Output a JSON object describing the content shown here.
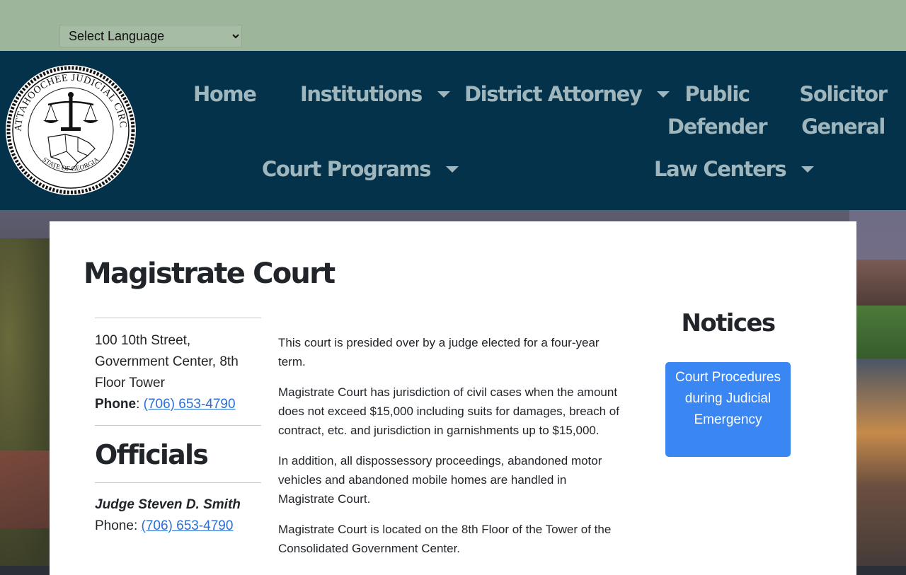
{
  "language_select": {
    "selected": "Select Language"
  },
  "colors": {
    "topbar": "#9db59b",
    "nav": "#05324b",
    "nav_text": "#9fb6bd",
    "accent": "#3a86f2",
    "link": "#2b6fd6"
  },
  "seal": {
    "ring_text": "CHATTAHOOCHEE JUDICIAL CIRCUIT",
    "bottom_text": "STATE OF GEORGIA"
  },
  "nav": {
    "home": "Home",
    "institutions": "Institutions",
    "district_attorney": "District Attorney",
    "public_defender_1": "Public",
    "public_defender_2": "Defender",
    "solicitor_general_1": "Solicitor",
    "solicitor_general_2": "General",
    "court_programs": "Court Programs",
    "law_centers": "Law Centers"
  },
  "page": {
    "title": "Magistrate Court"
  },
  "sidebar": {
    "address_line1": "100 10th Street,",
    "address_line2": "Government Center, 8th",
    "address_line3": "Floor Tower",
    "phone_label": "Phone",
    "phone": "(706) 653-4790",
    "officials_heading": "Officials",
    "judge_name": "Judge Steven D. Smith",
    "judge_phone_label": "Phone:",
    "judge_phone": "(706) 653-4790"
  },
  "main": {
    "p1": "This court is presided over by a judge elected for a four-year term.",
    "p2": "Magistrate Court has jurisdiction of civil cases when the amount does not exceed $15,000 including suits for damages, breach of contract, etc. and jurisdiction in garnishments up to $15,000.",
    "p3": "In addition, all dispossessory proceedings, abandoned motor vehicles and abandoned mobile homes are handled in Magistrate Court.",
    "p4": "Magistrate Court is located on the 8th Floor of the Tower of the Consolidated Government Center."
  },
  "notices": {
    "heading": "Notices",
    "button": "Court Procedures during Judicial Emergency"
  }
}
